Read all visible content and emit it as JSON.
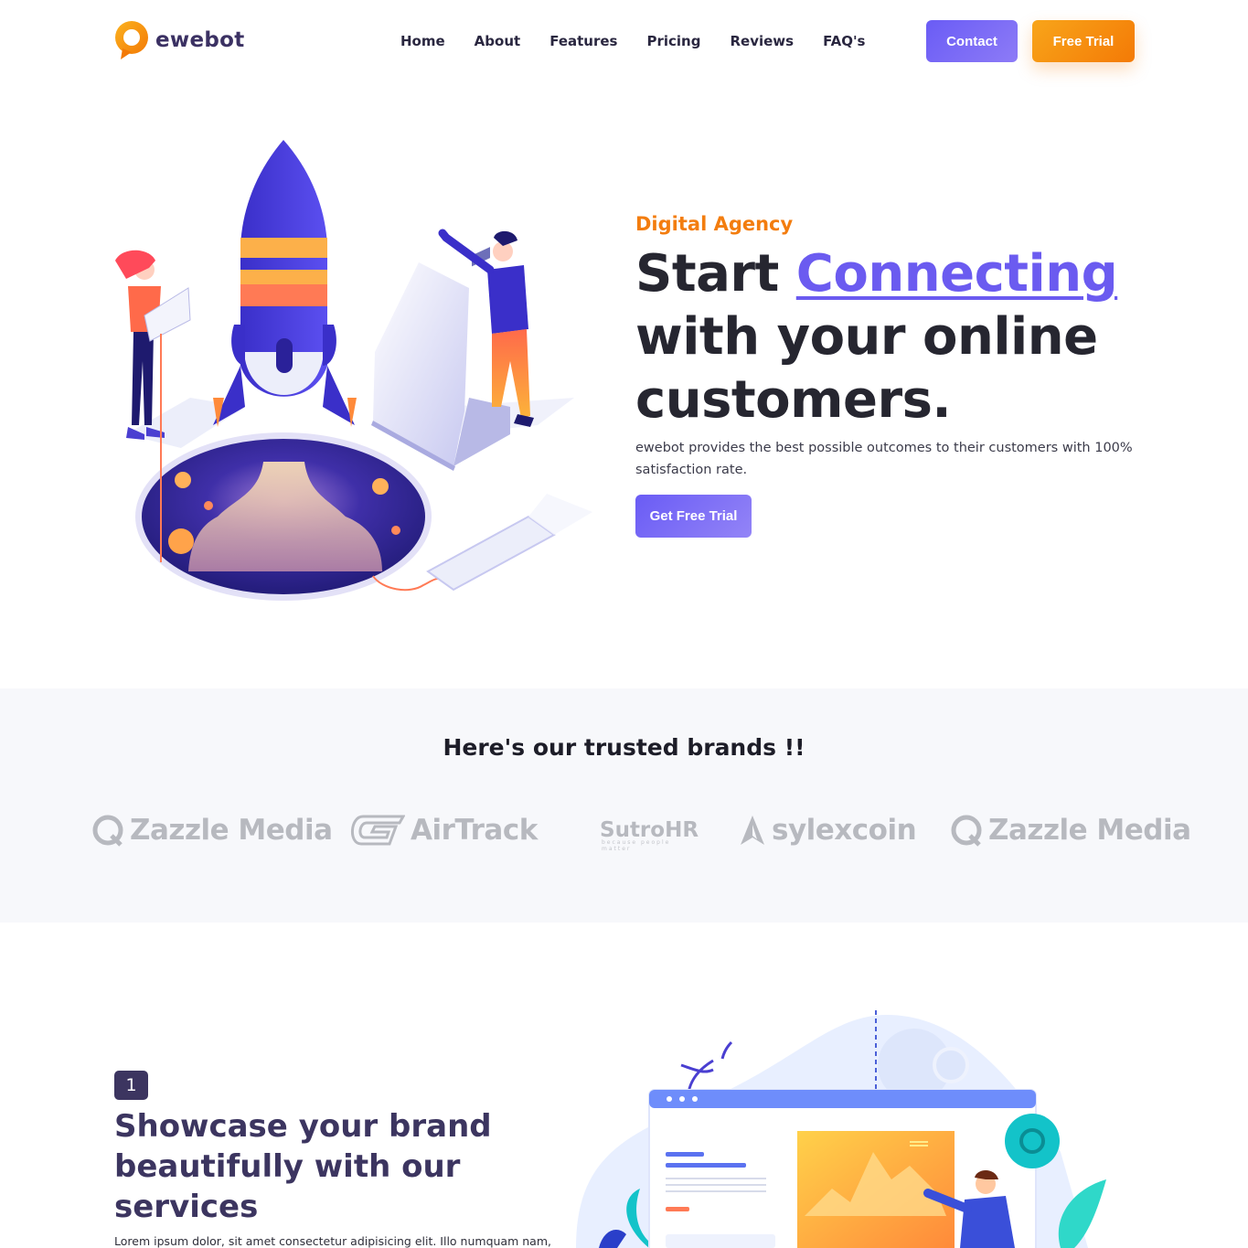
{
  "brand": {
    "name": "ewebot"
  },
  "nav": {
    "items": [
      "Home",
      "About",
      "Features",
      "Pricing",
      "Reviews",
      "FAQ's"
    ],
    "contact_label": "Contact",
    "trial_label": "Free Trial"
  },
  "hero": {
    "eyebrow": "Digital Agency",
    "headline_start": "Start ",
    "headline_accent": "Connecting",
    "headline_rest": "with your online customers.",
    "description": "ewebot provides the best possible outcomes to their customers with 100% satisfaction rate.",
    "cta_label": "Get Free Trial"
  },
  "brands": {
    "title": "Here's our trusted brands !!",
    "logos": [
      "Zazzle Media",
      "AirTrack",
      "SutroHR",
      "sylexcoin",
      "Zazzle Media"
    ],
    "sutro_tagline": "because people matter"
  },
  "feature": {
    "number": "1",
    "title": "Showcase your brand beautifully with our services",
    "description": "Lorem ipsum dolor, sit amet consectetur adipisicing elit. Illo numquam nam,"
  },
  "colors": {
    "primary": "#6b5bf0",
    "accent_orange": "#f47a06",
    "dark_navy": "#3c3560",
    "brand_gray": "#b7b9bf",
    "section_bg": "#f7f8fb"
  },
  "icons": {
    "logo": "speech-bubble-logo-icon",
    "zazzle": "zazzle-q-logo-icon",
    "airtrack": "airtrack-logo-icon",
    "sylexcoin": "sylexcoin-triangle-logo-icon"
  }
}
